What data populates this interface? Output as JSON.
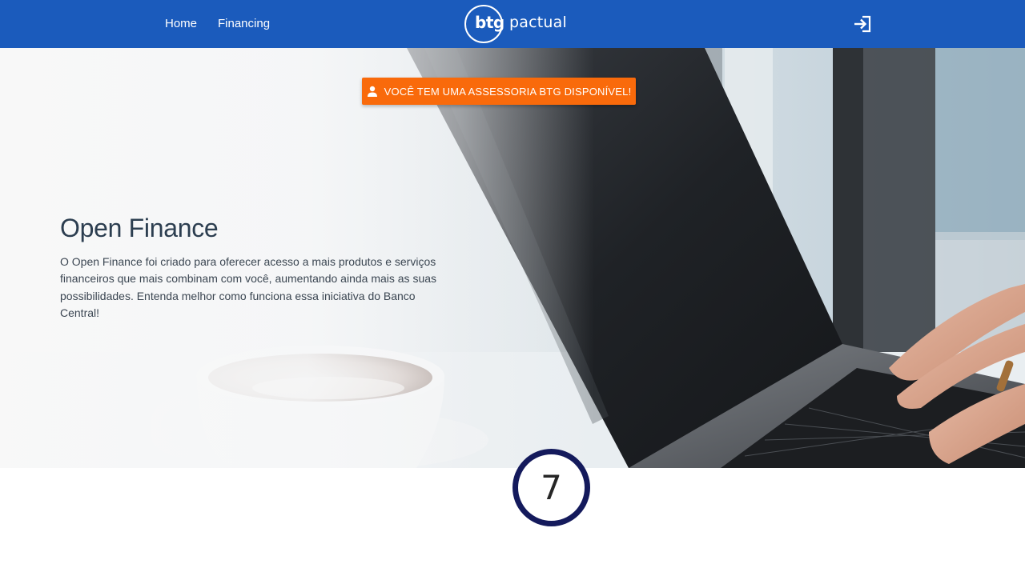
{
  "header": {
    "nav": [
      {
        "label": "Home"
      },
      {
        "label": "Financing"
      }
    ],
    "logo": {
      "part1": "btg",
      "part2": "pactual"
    },
    "login_icon": "login-arrow-icon",
    "background_color": "#1b5bbc"
  },
  "hero": {
    "cta_label": "VOCÊ TEM UMA ASSESSORIA BTG DISPONÍVEL!",
    "cta_icon": "person-icon",
    "cta_color": "#f96a0b",
    "title": "Open Finance",
    "description": "O Open Finance foi criado para oferecer acesso a mais produtos e serviços financeiros que mais combinam com você, aumentando ainda mais as suas possibilidades. Entenda melhor como funciona essa iniciativa do Banco Central!"
  },
  "step_indicator": {
    "value": "7",
    "border_color": "#141a5c"
  }
}
